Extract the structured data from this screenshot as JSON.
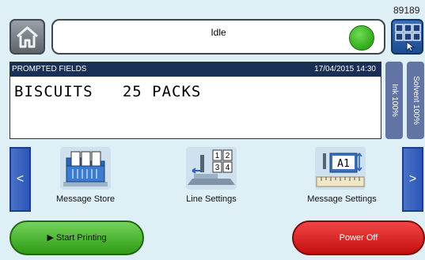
{
  "header": {
    "serial": "89189",
    "status_text": "Idle",
    "status_color": "#31a91b"
  },
  "prompted_fields": {
    "title": "PROMPTED FIELDS",
    "datetime": "17/04/2015  14:30",
    "message": "BISCUITS   25 PACKS"
  },
  "gauges": {
    "ink": "Ink 100%",
    "solvent": "Solvent 100%"
  },
  "nav": {
    "prev": "<",
    "next": ">"
  },
  "tiles": [
    {
      "label": "Message Store",
      "icon": "message-store-icon"
    },
    {
      "label": "Line Settings",
      "icon": "line-settings-icon",
      "digits": [
        "1",
        "2",
        "3",
        "4"
      ]
    },
    {
      "label": "Message Settings",
      "icon": "message-settings-icon",
      "preview": "A1"
    }
  ],
  "buttons": {
    "start_printing": "Start Printing",
    "power_off": "Power Off"
  },
  "colors": {
    "background": "#dfeff6",
    "header_bar": "#1a2f55",
    "gauge": "#6274a3",
    "start": "#2f9b16",
    "power": "#c30f0f"
  }
}
